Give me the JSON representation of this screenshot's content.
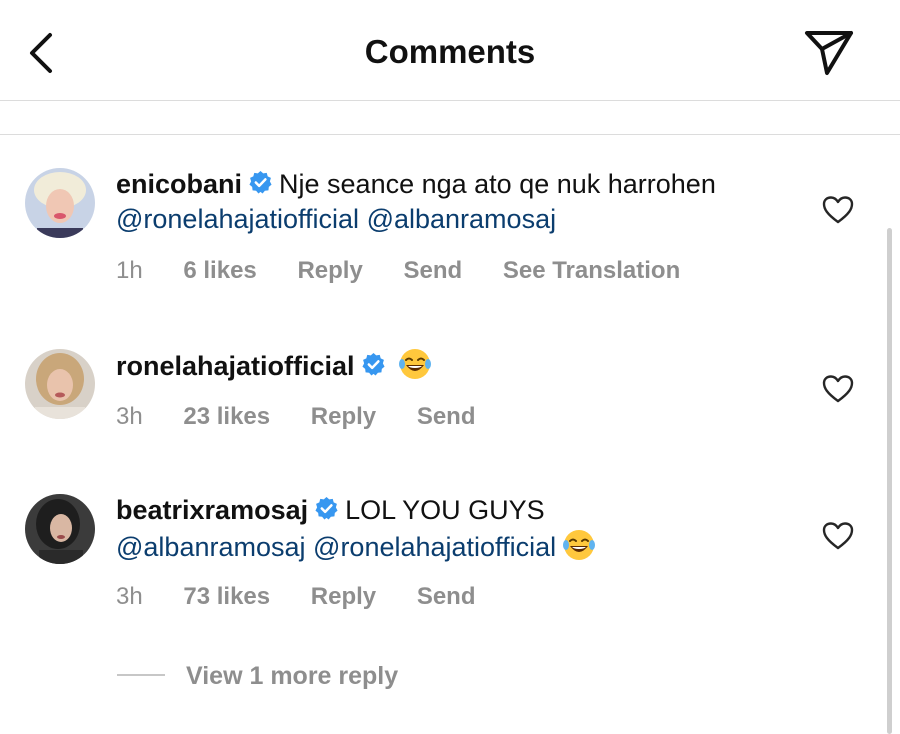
{
  "header": {
    "title": "Comments",
    "back_icon": "chevron-left-icon",
    "share_icon": "paper-plane-icon"
  },
  "comments": [
    {
      "username": "enicobani",
      "verified": true,
      "text": "Nje seance nga ato qe nuk harrohen",
      "mentions": [
        "@ronelahajatiofficial",
        "@albanramosaj"
      ],
      "time": "1h",
      "likes": "6 likes",
      "reply_label": "Reply",
      "send_label": "Send",
      "translation_label": "See Translation"
    },
    {
      "username": "ronelahajatiofficial",
      "verified": true,
      "emoji": "face-with-tears-of-joy",
      "time": "3h",
      "likes": "23 likes",
      "reply_label": "Reply",
      "send_label": "Send"
    },
    {
      "username": "beatrixramosaj",
      "verified": true,
      "text": "LOL YOU GUYS",
      "mentions": [
        "@albanramosaj",
        "@ronelahajatiofficial"
      ],
      "emoji": "face-with-tears-of-joy",
      "time": "3h",
      "likes": "73 likes",
      "reply_label": "Reply",
      "send_label": "Send"
    }
  ],
  "view_more": {
    "label": "View 1 more reply"
  },
  "colors": {
    "mention": "#0b3d6e",
    "verified": "#3797f0",
    "meta": "#8e8e8e",
    "separator": "#dcdcdc"
  }
}
